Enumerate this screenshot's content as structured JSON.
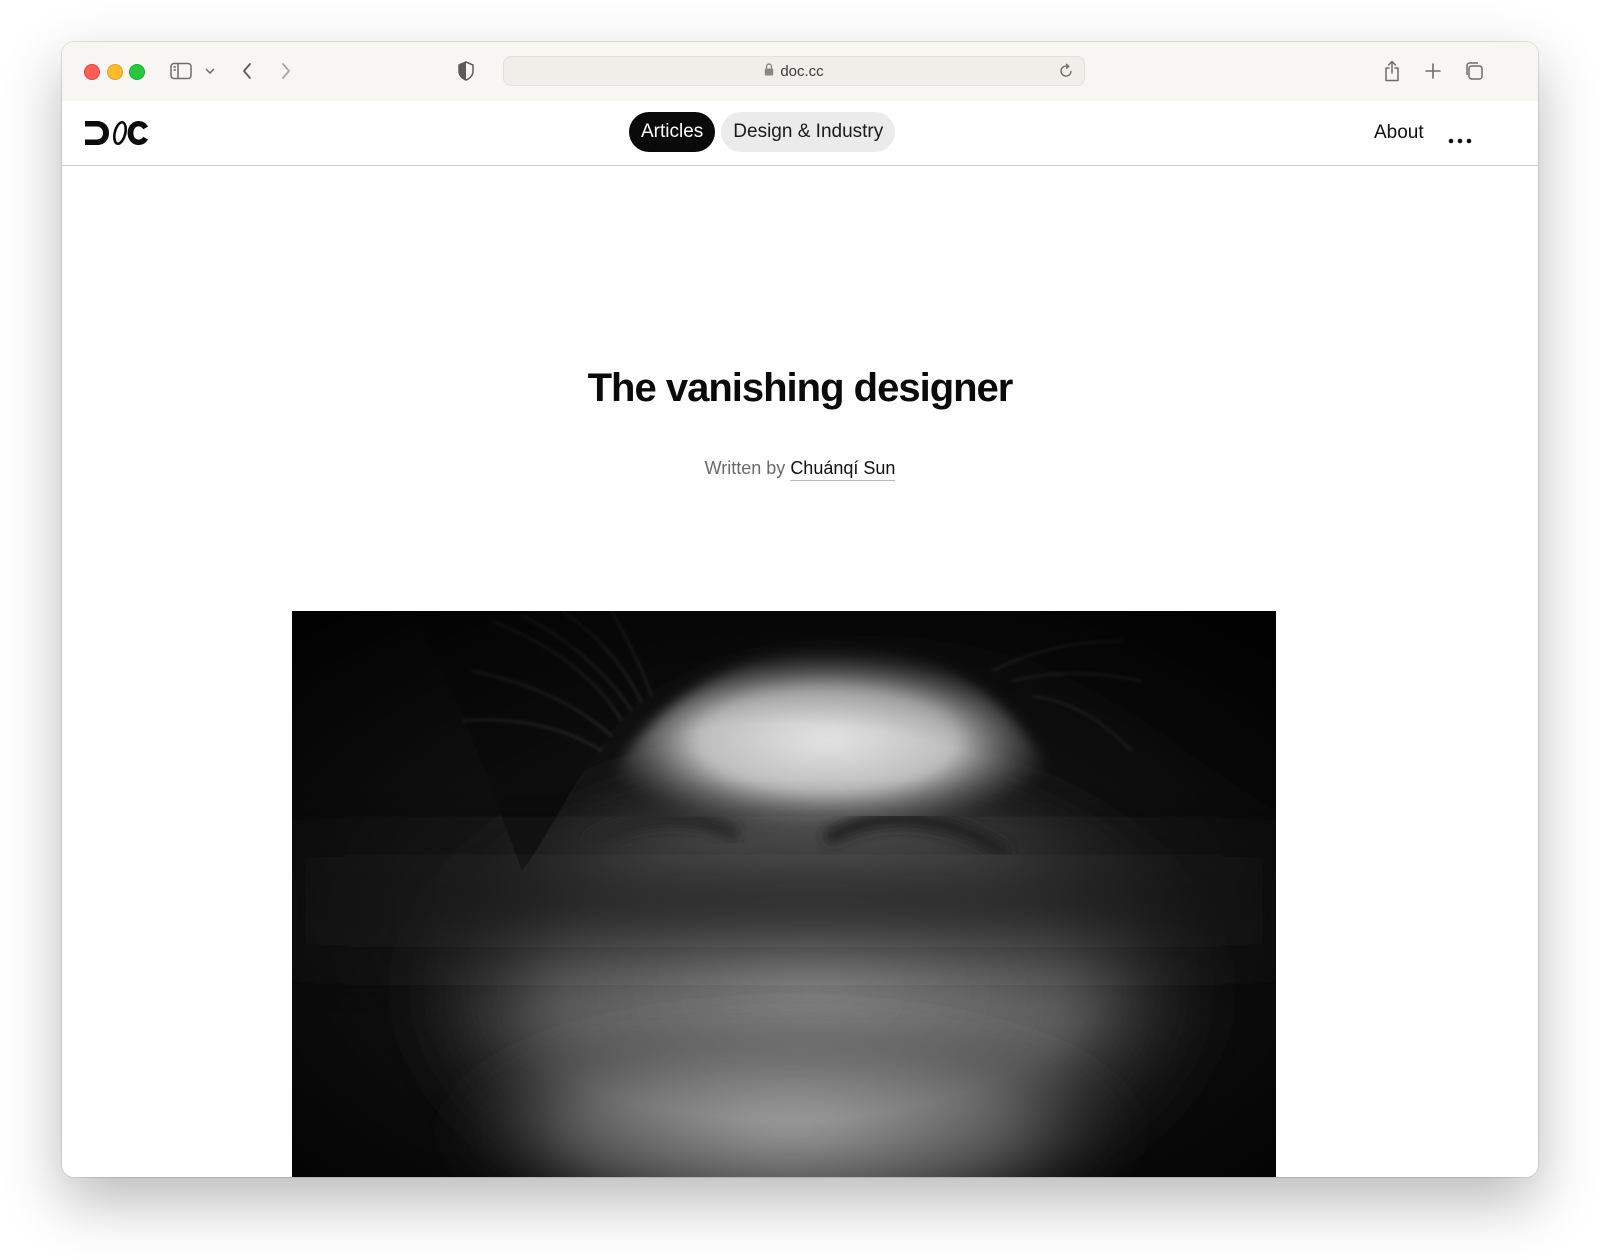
{
  "browser": {
    "url": "doc.cc"
  },
  "site": {
    "logo_text": "DOC",
    "nav": [
      {
        "label": "Articles",
        "active": true
      },
      {
        "label": "Design & Industry",
        "active": false
      }
    ],
    "about_label": "About"
  },
  "article": {
    "title": "The vanishing designer",
    "byline_prefix": "Written by",
    "author": "Chuánqí Sun"
  },
  "icons": {
    "toolbar": [
      "sidebar-icon",
      "chevron-down-icon",
      "back-icon",
      "forward-icon",
      "privacy-shield-icon",
      "lock-icon",
      "reload-icon",
      "share-icon",
      "new-tab-icon",
      "tab-overview-icon"
    ],
    "site": [
      "more-icon"
    ]
  },
  "colors": {
    "close": "#fe5f57",
    "minimize": "#febc2e",
    "maximize": "#28c840",
    "active_pill": "#0a0a0a",
    "inactive_pill": "#ebebeb"
  }
}
